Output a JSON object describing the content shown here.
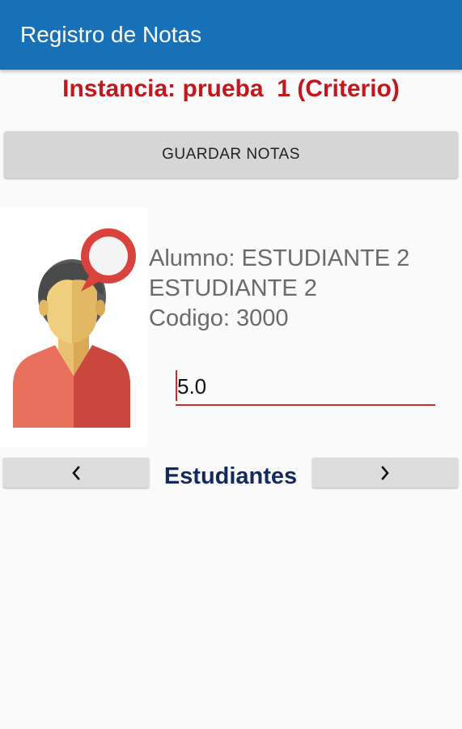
{
  "app": {
    "title": "Registro de Notas",
    "primary_color": "#1870b6",
    "accent_color": "#c2171d"
  },
  "header": {
    "instance_text": "Instancia: prueba  1 (Criterio)"
  },
  "actions": {
    "save_label": "GUARDAR NOTAS"
  },
  "student": {
    "avatar_icon": "student-avatar-icon",
    "name_line1": "Alumno: ESTUDIANTE 2",
    "name_line2": "ESTUDIANTE 2",
    "code_text": "Codigo: 3000"
  },
  "grade": {
    "value": "5.0"
  },
  "navigation": {
    "label": "Estudiantes",
    "prev_icon": "chevron-left-icon",
    "next_icon": "chevron-right-icon"
  }
}
